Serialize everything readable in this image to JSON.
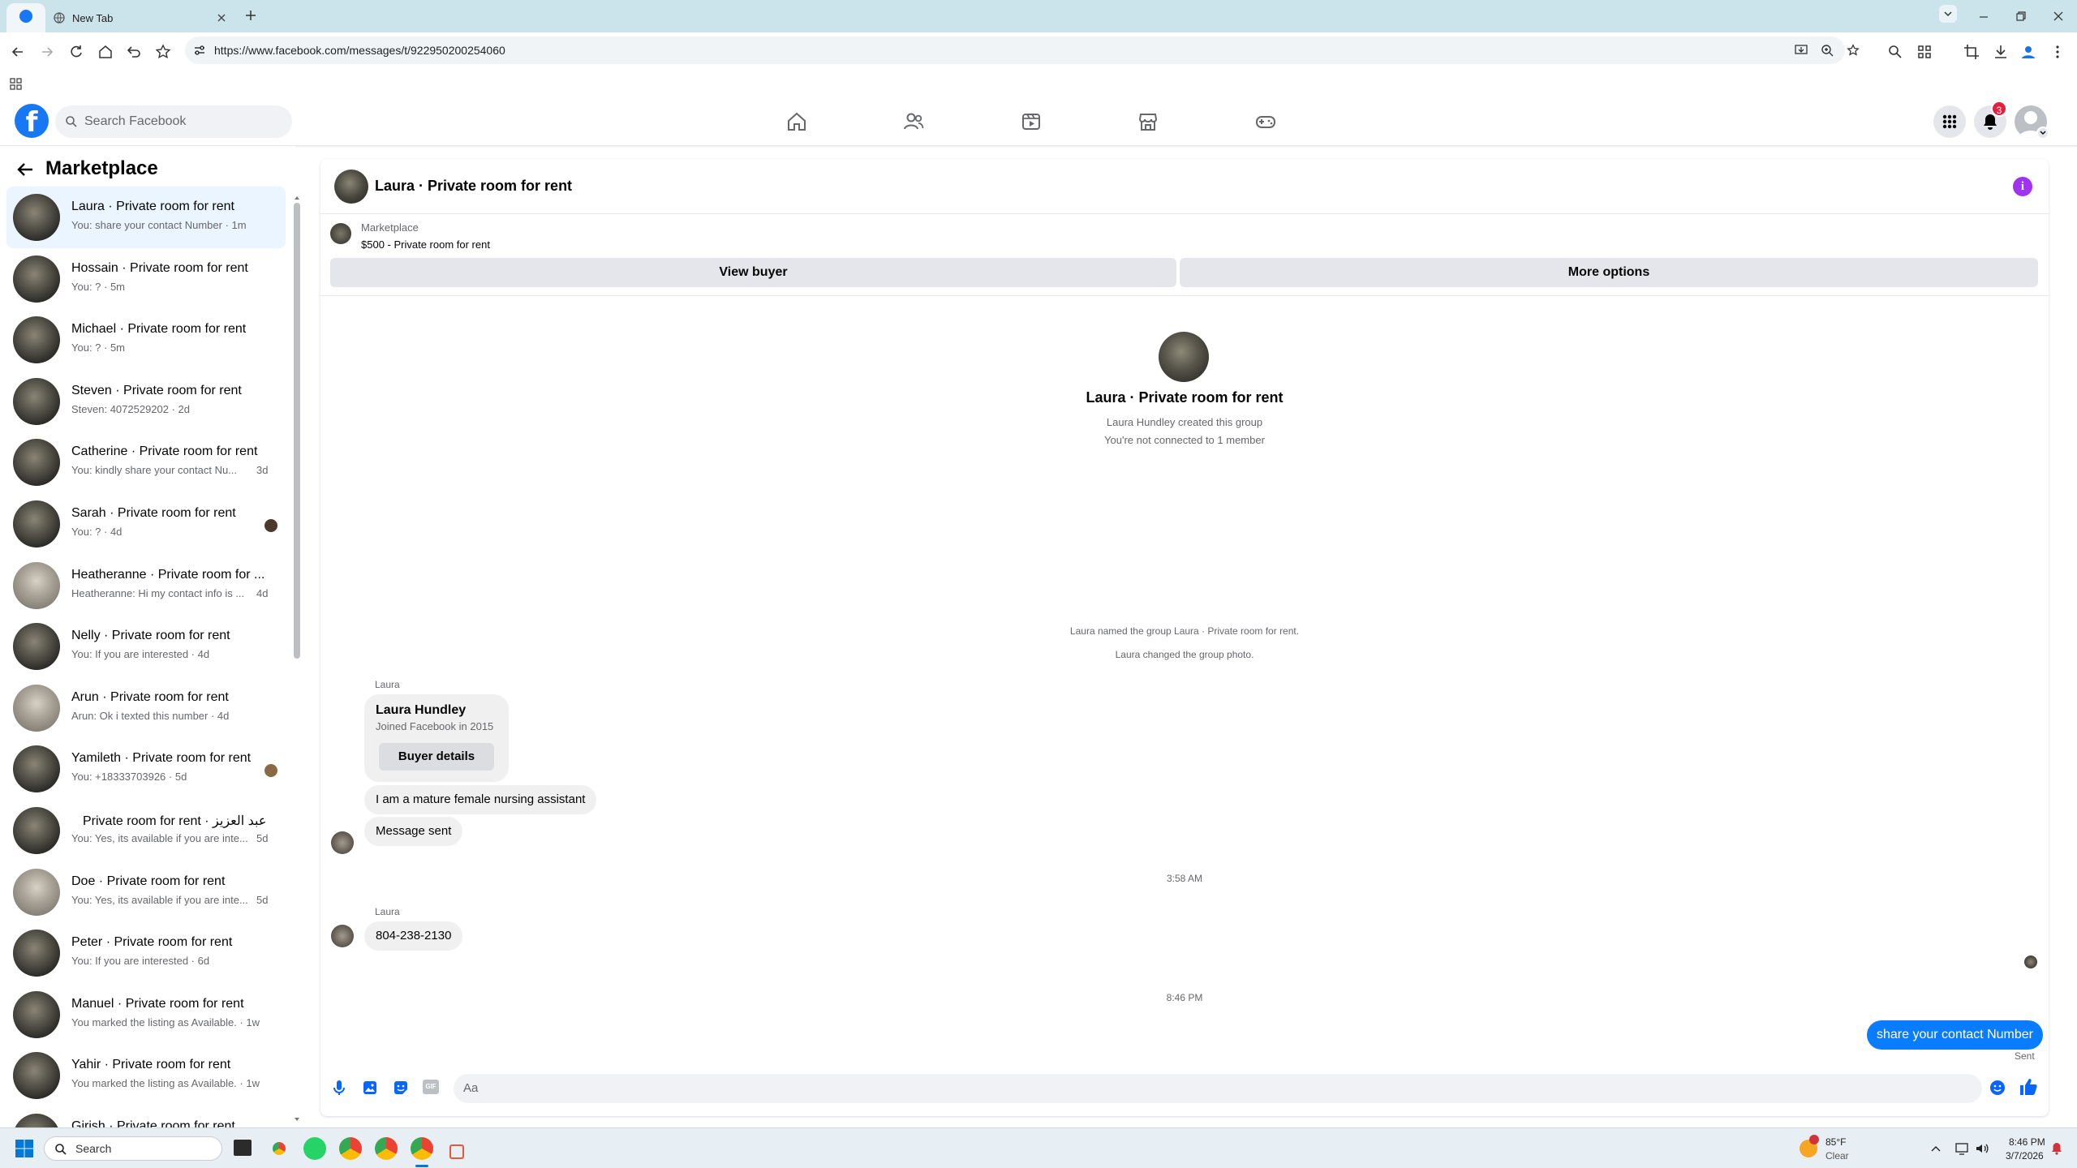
{
  "browser": {
    "tab_title": "New Tab",
    "url": "https://www.facebook.com/messages/t/922950200254060"
  },
  "facebook": {
    "logo": "f",
    "search_placeholder": "Search Facebook",
    "notifications_count": "3"
  },
  "sidebar": {
    "title": "Marketplace",
    "conversations": [
      {
        "name": "Laura · Private room for rent",
        "preview": "You: share your contact Number · 1m",
        "time": ""
      },
      {
        "name": "Hossain · Private room for rent",
        "preview": "You: ? · 5m",
        "time": ""
      },
      {
        "name": "Michael · Private room for rent",
        "preview": "You: ? · 5m",
        "time": ""
      },
      {
        "name": "Steven · Private room for rent",
        "preview": "Steven: 4072529202 · 2d",
        "time": ""
      },
      {
        "name": "Catherine · Private room for rent",
        "preview": "You: kindly share your contact Nu...",
        "time": "3d"
      },
      {
        "name": "Sarah · Private room for rent",
        "preview": "You: ? · 4d",
        "time": ""
      },
      {
        "name": "Heatheranne · Private room for ...",
        "preview": "Heatheranne: Hi my contact info is ...",
        "time": "4d"
      },
      {
        "name": "Nelly · Private room for rent",
        "preview": "You: If you are interested · 4d",
        "time": ""
      },
      {
        "name": "Arun · Private room for rent",
        "preview": "Arun: Ok i texted this number · 4d",
        "time": ""
      },
      {
        "name": "Yamileth · Private room for rent",
        "preview": "You: +18333703926 · 5d",
        "time": ""
      },
      {
        "name": "عبد العزيز · Private room for rent",
        "preview": "You: Yes, its available if you are inte...",
        "time": "5d"
      },
      {
        "name": "Doe · Private room for rent",
        "preview": "You: Yes, its available if you are inte...",
        "time": "5d"
      },
      {
        "name": "Peter · Private room for rent",
        "preview": "You: If you are interested · 6d",
        "time": ""
      },
      {
        "name": "Manuel · Private room for rent",
        "preview": "You marked the listing as Available. · 1w",
        "time": ""
      },
      {
        "name": "Yahir · Private room for rent",
        "preview": "You marked the listing as Available. · 1w",
        "time": ""
      },
      {
        "name": "Girish · Private room for rent",
        "preview": "",
        "time": ""
      }
    ]
  },
  "chat": {
    "title": "Laura · Private room for rent",
    "marketplace_label": "Marketplace",
    "listing": "$500 - Private room for rent",
    "view_buyer": "View buyer",
    "more_options": "More options",
    "group_title": "Laura · Private room for rent",
    "group_created": "Laura Hundley created this group",
    "group_connected": "You're not connected to 1 member",
    "sys1": "Laura named the group Laura · Private room for rent.",
    "sys2": "Laura changed the group photo.",
    "sender1": "Laura",
    "card_name": "Laura Hundley",
    "card_joined": "Joined Facebook in 2015",
    "card_button": "Buyer details",
    "msg1": "I am a mature female nursing assistant",
    "msg2": "Message sent",
    "time1": "3:58 AM",
    "sender2": "Laura",
    "msg3": "804-238-2130",
    "time2": "8:46 PM",
    "my_msg": "share your contact Number",
    "my_status": "Sent",
    "composer_placeholder": "Aa"
  },
  "taskbar": {
    "search": "Search",
    "weather_temp": "85°F",
    "weather_desc": "Clear",
    "time": "8:46 PM",
    "date": "3/7/2026"
  },
  "colors": {
    "fb_blue": "#1877f2",
    "messenger_blue": "#0a7cff",
    "info_purple": "#a033f0",
    "badge_red": "#e41e3f"
  }
}
